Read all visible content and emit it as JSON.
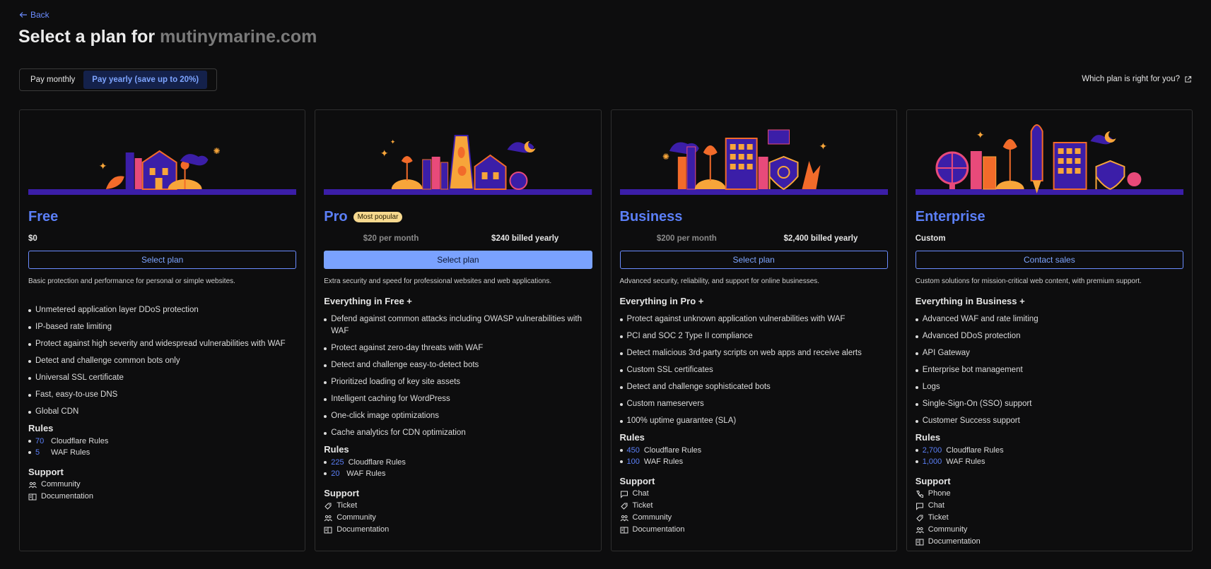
{
  "header": {
    "back_label": "Back",
    "title_prefix": "Select a plan for ",
    "domain": "mutinymarine.com"
  },
  "billing_toggle": {
    "monthly_label": "Pay monthly",
    "yearly_label": "Pay yearly (save up to 20%)",
    "selected": "yearly"
  },
  "help_link": "Which plan is right for you?",
  "plans": [
    {
      "name": "Free",
      "badge": "",
      "price": "$0",
      "button": "Select plan",
      "description": "Basic protection and performance for personal or simple websites.",
      "everything_in": "",
      "features": [
        "Unmetered application layer DDoS protection",
        "IP-based rate limiting",
        "Protect against high severity and widespread vulnerabilities with WAF",
        "Detect and challenge common bots only",
        "Universal SSL certificate",
        "Fast, easy-to-use DNS",
        "Global CDN"
      ],
      "rules_title": "Rules",
      "rules": [
        {
          "count": "70",
          "label": "Cloudflare Rules"
        },
        {
          "count": "5",
          "label": "WAF Rules"
        }
      ],
      "support_title": "Support",
      "support": [
        {
          "icon": "community-icon",
          "label": "Community"
        },
        {
          "icon": "documentation-icon",
          "label": "Documentation"
        }
      ]
    },
    {
      "name": "Pro",
      "badge": "Most popular",
      "price_monthly": "$20 per month",
      "price_yearly": "$240 billed yearly",
      "button": "Select plan",
      "description": "Extra security and speed for professional websites and web applications.",
      "everything_in": "Everything in Free +",
      "features": [
        "Defend against common attacks including OWASP vulnerabilities with WAF",
        "Protect against zero-day threats with WAF",
        "Detect and challenge easy-to-detect bots",
        "Prioritized loading of key site assets",
        "Intelligent caching for WordPress",
        "One-click image optimizations",
        "Cache analytics for CDN optimization"
      ],
      "rules_title": "Rules",
      "rules": [
        {
          "count": "225",
          "label": "Cloudflare Rules"
        },
        {
          "count": "20",
          "label": "WAF Rules"
        }
      ],
      "support_title": "Support",
      "support": [
        {
          "icon": "ticket-icon",
          "label": "Ticket"
        },
        {
          "icon": "community-icon",
          "label": "Community"
        },
        {
          "icon": "documentation-icon",
          "label": "Documentation"
        }
      ]
    },
    {
      "name": "Business",
      "badge": "",
      "price_monthly": "$200 per month",
      "price_yearly": "$2,400 billed yearly",
      "button": "Select plan",
      "description": "Advanced security, reliability, and support for online businesses.",
      "everything_in": "Everything in Pro +",
      "features": [
        "Protect against unknown application vulnerabilities with WAF",
        "PCI and SOC 2 Type II compliance",
        "Detect malicious 3rd-party scripts on web apps and receive alerts",
        "Custom SSL certificates",
        "Detect and challenge sophisticated bots",
        "Custom nameservers",
        "100% uptime guarantee (SLA)"
      ],
      "rules_title": "Rules",
      "rules": [
        {
          "count": "450",
          "label": "Cloudflare Rules"
        },
        {
          "count": "100",
          "label": "WAF Rules"
        }
      ],
      "support_title": "Support",
      "support": [
        {
          "icon": "chat-icon",
          "label": "Chat"
        },
        {
          "icon": "ticket-icon",
          "label": "Ticket"
        },
        {
          "icon": "community-icon",
          "label": "Community"
        },
        {
          "icon": "documentation-icon",
          "label": "Documentation"
        }
      ]
    },
    {
      "name": "Enterprise",
      "badge": "",
      "price": "Custom",
      "button": "Contact sales",
      "description": "Custom solutions for mission-critical web content, with premium support.",
      "everything_in": "Everything in Business +",
      "features": [
        "Advanced WAF and rate limiting",
        "Advanced DDoS protection",
        "API Gateway",
        "Enterprise bot management",
        "Logs",
        "Single-Sign-On (SSO) support",
        "Customer Success support"
      ],
      "rules_title": "Rules",
      "rules": [
        {
          "count": "2,700",
          "label": "Cloudflare Rules"
        },
        {
          "count": "1,000",
          "label": "WAF Rules"
        }
      ],
      "support_title": "Support",
      "support": [
        {
          "icon": "phone-icon",
          "label": "Phone"
        },
        {
          "icon": "chat-icon",
          "label": "Chat"
        },
        {
          "icon": "ticket-icon",
          "label": "Ticket"
        },
        {
          "icon": "community-icon",
          "label": "Community"
        },
        {
          "icon": "documentation-icon",
          "label": "Documentation"
        }
      ]
    }
  ],
  "colors": {
    "accent": "#5b7ff7",
    "primary_button": "#7aa2ff",
    "illustration_orange": "#f26b2a",
    "illustration_purple": "#3b1ea8"
  }
}
